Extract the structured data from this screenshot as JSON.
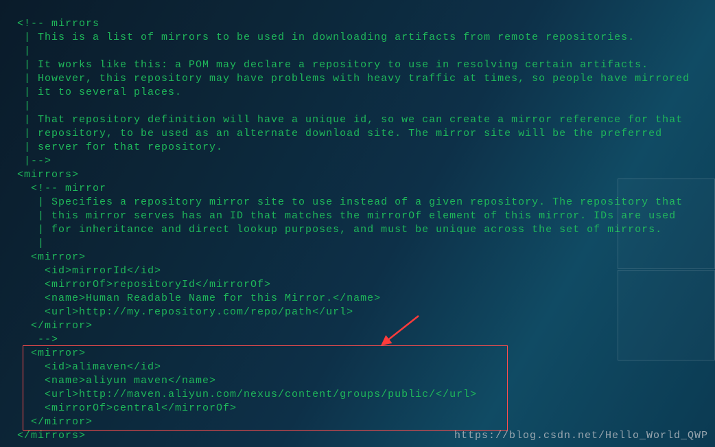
{
  "code": {
    "l01": "<!-- mirrors",
    "l02": " | This is a list of mirrors to be used in downloading artifacts from remote repositories.",
    "l03": " |",
    "l04": " | It works like this: a POM may declare a repository to use in resolving certain artifacts.",
    "l05": " | However, this repository may have problems with heavy traffic at times, so people have mirrored",
    "l06": " | it to several places.",
    "l07": " |",
    "l08": " | That repository definition will have a unique id, so we can create a mirror reference for that",
    "l09": " | repository, to be used as an alternate download site. The mirror site will be the preferred",
    "l10": " | server for that repository.",
    "l11": " |-->",
    "l12": "<mirrors>",
    "l13": "  <!-- mirror",
    "l14": "   | Specifies a repository mirror site to use instead of a given repository. The repository that",
    "l15": "   | this mirror serves has an ID that matches the mirrorOf element of this mirror. IDs are used",
    "l16": "   | for inheritance and direct lookup purposes, and must be unique across the set of mirrors.",
    "l17": "   |",
    "l18": "  <mirror>",
    "l19": "    <id>mirrorId</id>",
    "l20": "    <mirrorOf>repositoryId</mirrorOf>",
    "l21": "    <name>Human Readable Name for this Mirror.</name>",
    "l22": "    <url>http://my.repository.com/repo/path</url>",
    "l23": "  </mirror>",
    "l24": "   -->",
    "l25": "  <mirror>",
    "l26": "    <id>alimaven</id>",
    "l27": "    <name>aliyun maven</name>",
    "l28": "    <url>http://maven.aliyun.com/nexus/content/groups/public/</url>",
    "l29": "    <mirrorOf>central</mirrorOf>",
    "l30": "  </mirror>",
    "l31": "</mirrors>"
  },
  "watermark": "https://blog.csdn.net/Hello_World_QWP"
}
